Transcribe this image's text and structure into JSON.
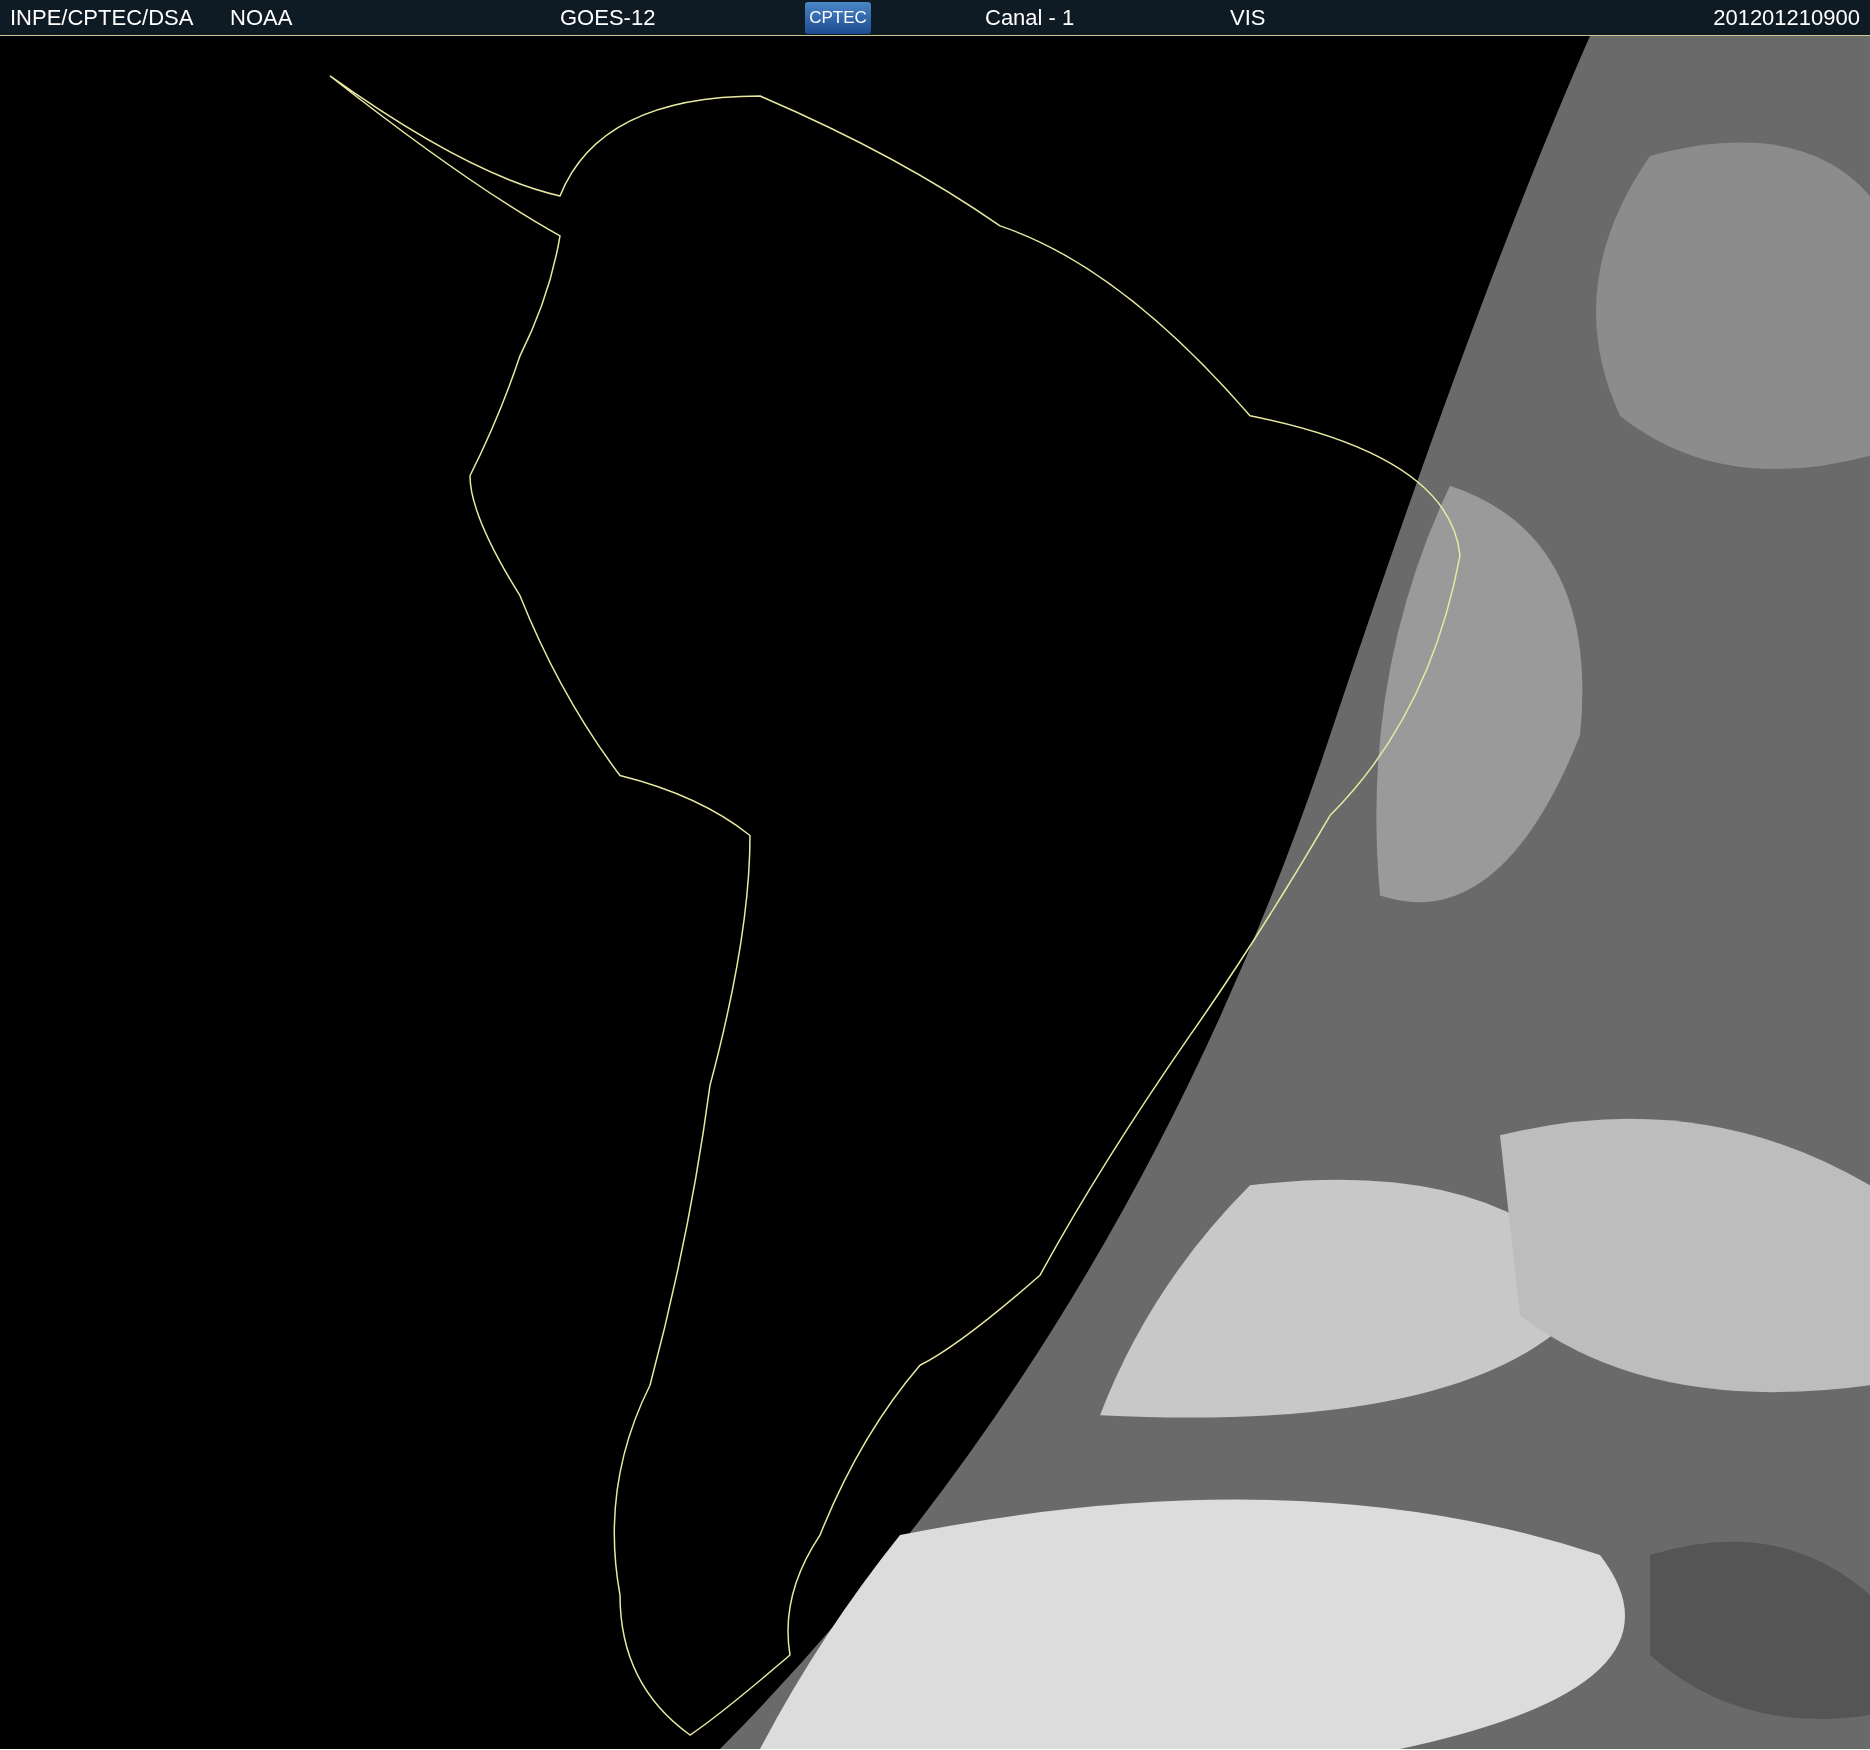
{
  "header": {
    "items": [
      {
        "kind": "text",
        "text": "INPE/CPTEC/DSA"
      },
      {
        "kind": "text",
        "text": "NOAA"
      },
      {
        "kind": "text",
        "text": "GOES-12"
      },
      {
        "kind": "logo",
        "text": "CPTEC"
      },
      {
        "kind": "text",
        "text": "Canal - 1"
      },
      {
        "kind": "text",
        "text": "VIS"
      },
      {
        "kind": "text",
        "text": "201201210900"
      }
    ]
  }
}
